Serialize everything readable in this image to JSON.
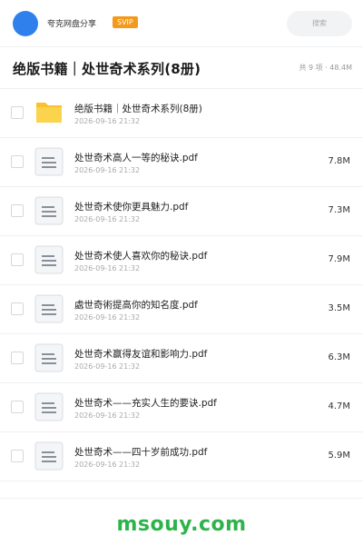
{
  "header": {
    "app_name": "夸克网盘分享",
    "badge": "SVIP",
    "search_placeholder": "搜索"
  },
  "folder": {
    "title": "绝版书籍｜处世奇术系列(8册)",
    "meta": "共 9 项 · 48.4M"
  },
  "files": [
    {
      "name": "绝版书籍｜处世奇术系列(8册)",
      "date": "2026-09-16 21:32",
      "size": "",
      "icon": "folder-icon"
    },
    {
      "name": "处世奇术高人一等的秘诀.pdf",
      "date": "2026-09-16 21:32",
      "size": "7.8M",
      "icon": "document-icon"
    },
    {
      "name": "处世奇术使你更具魅力.pdf",
      "date": "2026-09-16 21:32",
      "size": "7.3M",
      "icon": "document-icon"
    },
    {
      "name": "处世奇术使人喜欢你的秘诀.pdf",
      "date": "2026-09-16 21:32",
      "size": "7.9M",
      "icon": "document-icon"
    },
    {
      "name": "處世奇術提高你的知名度.pdf",
      "date": "2026-09-16 21:32",
      "size": "3.5M",
      "icon": "document-icon"
    },
    {
      "name": "处世奇术赢得友谊和影响力.pdf",
      "date": "2026-09-16 21:32",
      "size": "6.3M",
      "icon": "document-icon"
    },
    {
      "name": "处世奇术——充实人生的要诀.pdf",
      "date": "2026-09-16 21:32",
      "size": "4.7M",
      "icon": "document-icon"
    },
    {
      "name": "处世奇术——四十岁前成功.pdf",
      "date": "2026-09-16 21:32",
      "size": "5.9M",
      "icon": "document-icon"
    }
  ],
  "footer": {
    "watermark": "msouy.com"
  },
  "colors": {
    "avatar": "#2f80ed",
    "badge": "#f39a1a",
    "folder": "#fbc02d",
    "watermark": "#2db34a"
  }
}
